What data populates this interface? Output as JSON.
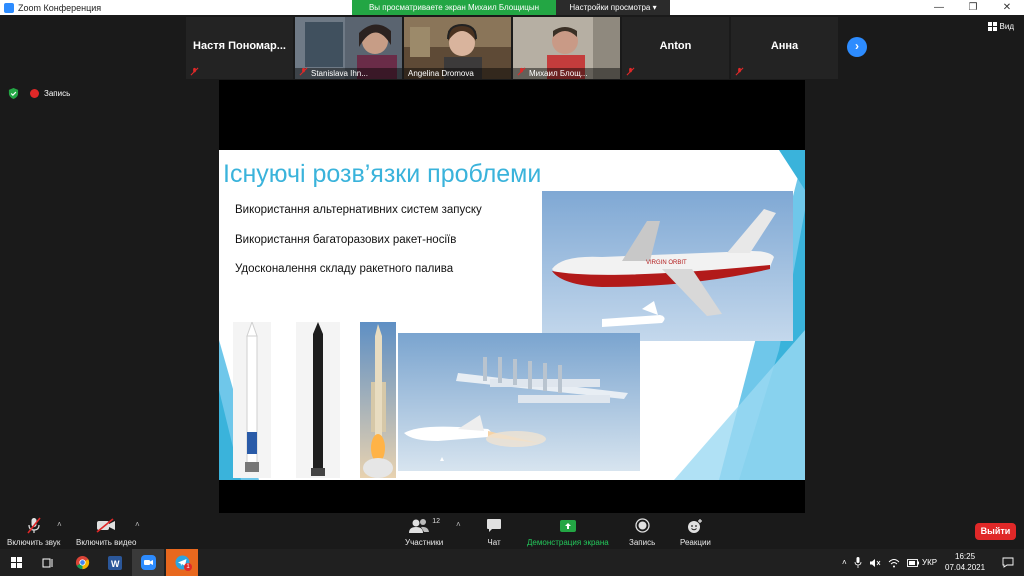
{
  "window": {
    "title": "Zoom Конференция"
  },
  "share_banner": {
    "viewing_text": "Вы просматриваете экран Михаил Блощицын",
    "settings_label": "Настройки просмотра"
  },
  "view_label": "Вид",
  "participants_strip": [
    {
      "name": "Настя  Пономар...",
      "video": false
    },
    {
      "name": "Stanislava Ihn...",
      "video": true
    },
    {
      "name": "Angelina Dromova",
      "video": true
    },
    {
      "name": "Михаил Блощ...",
      "video": true
    },
    {
      "name": "Anton",
      "video": false
    },
    {
      "name": "Анна",
      "video": false
    }
  ],
  "recording_label": "Запись",
  "slide": {
    "title": "Існуючі розв’язки проблеми",
    "bullets": [
      "Використання альтернативних систем запуску",
      "Використання багаторазових ракет-носіїв",
      "Удосконалення складу ракетного палива"
    ],
    "plane_livery": "VIRGIN ORBIT"
  },
  "toolbar": {
    "mute_label": "Включить звук",
    "video_label": "Включить видео",
    "participants_label": "Участники",
    "participants_count": "12",
    "chat_label": "Чат",
    "share_label": "Демонстрация экрана",
    "record_label": "Запись",
    "reactions_label": "Реакции",
    "exit_label": "Выйти"
  },
  "taskbar": {
    "language": "УКР",
    "time": "16:25",
    "date": "07.04.2021",
    "telegram_badge": "1"
  },
  "colors": {
    "accent": "#2d8cff",
    "share_green": "#23a644",
    "exit_red": "#e02828",
    "slide_title": "#3ab3db"
  }
}
